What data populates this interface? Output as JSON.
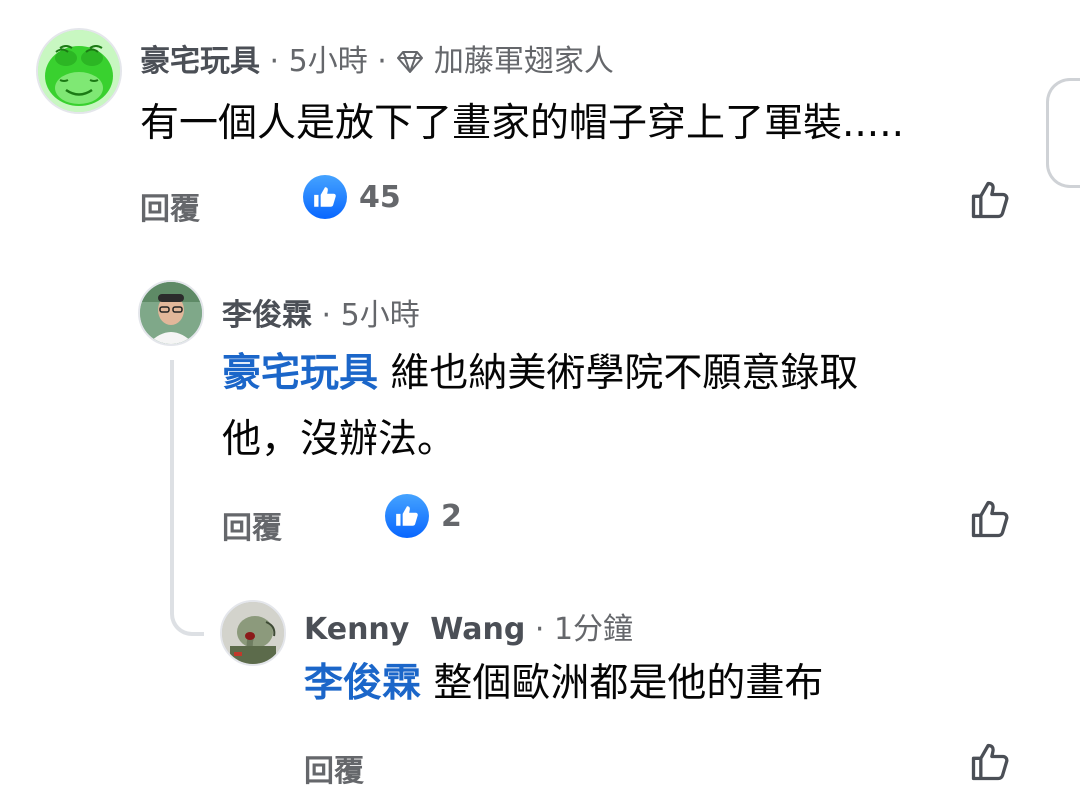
{
  "comments": [
    {
      "author": "豪宅玩具",
      "time": "5小時",
      "badge": "加藤軍翅家人",
      "text": "有一個人是放下了畫家的帽子穿上了軍裝.....",
      "reply_label": "回覆",
      "likes": "45"
    },
    {
      "author": "李俊霖",
      "time": "5小時",
      "mention": "豪宅玩具",
      "text_line1": "維也納美術學院不願意錄取",
      "text_line2": "他，沒辦法。",
      "reply_label": "回覆",
      "likes": "2"
    },
    {
      "author": "Kenny  Wang",
      "time": "1分鐘",
      "mention": "李俊霖",
      "text": "整個歐洲都是他的畫布",
      "reply_label": "回覆"
    }
  ],
  "separator": "·",
  "icons": {
    "like_badge": "thumbs-up-badge-icon",
    "like_button": "thumbs-up-outline-icon",
    "badge": "diamond-icon"
  },
  "colors": {
    "mention": "#1b66c9",
    "like_badge": "#0866ff",
    "meta": "#65676b"
  }
}
